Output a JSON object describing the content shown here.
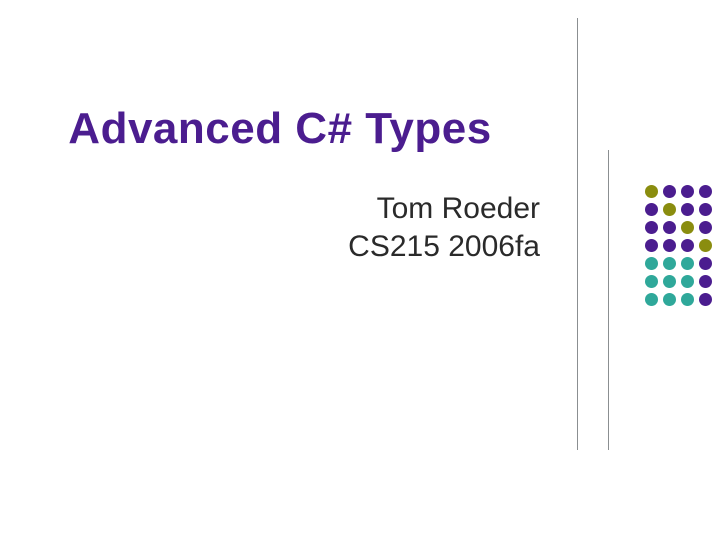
{
  "title": "Advanced C# Types",
  "subtitle": {
    "line1": "Tom Roeder",
    "line2": "CS215 2006fa"
  },
  "colors": {
    "title_color": "#4b1d8f",
    "body_color": "#2a2a2a",
    "accent_olive": "#8a8d0f",
    "accent_purple": "#4b1d8f",
    "accent_teal": "#2fa89a",
    "line_gray": "#8b8f91"
  }
}
